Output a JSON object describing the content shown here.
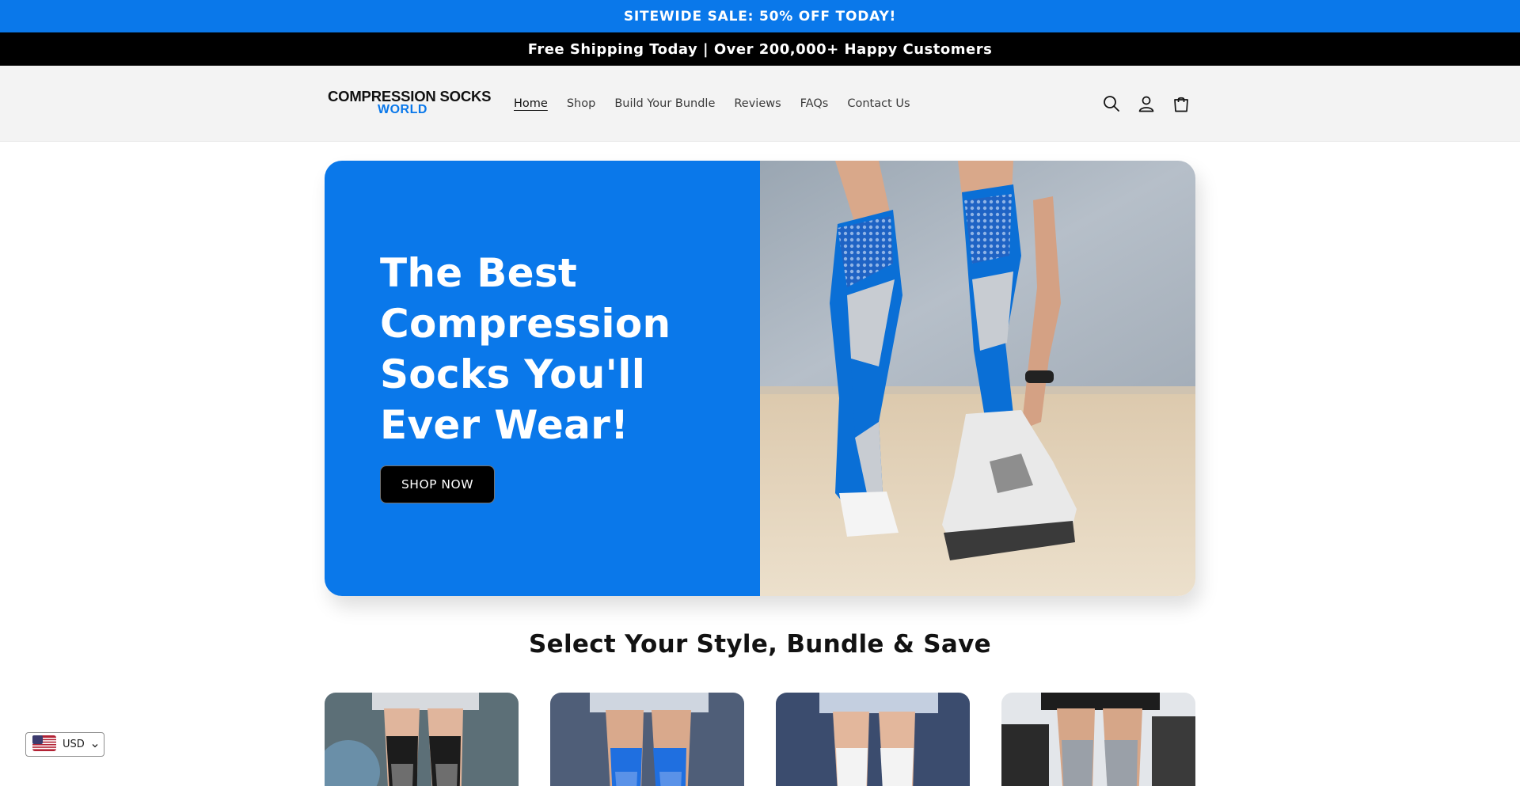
{
  "announcement": {
    "sale": "SITEWIDE SALE: 50% OFF TODAY!",
    "shipping": "Free Shipping Today | Over 200,000+ Happy Customers"
  },
  "header": {
    "logo_line1": "COMPRESSION SOCKS",
    "logo_line2": "WORLD",
    "nav": [
      {
        "label": "Home",
        "active": true
      },
      {
        "label": "Shop"
      },
      {
        "label": "Build Your Bundle"
      },
      {
        "label": "Reviews"
      },
      {
        "label": "FAQs"
      },
      {
        "label": "Contact Us"
      }
    ],
    "icons": [
      "search-icon",
      "account-icon",
      "cart-icon"
    ]
  },
  "hero": {
    "title": "The Best Compression Socks You'll Ever Wear!",
    "button": "SHOP NOW"
  },
  "collection": {
    "title": "Select Your Style, Bundle & Save"
  },
  "currency": {
    "code": "USD"
  },
  "colors": {
    "brand_blue": "#0a78ea",
    "black": "#000000",
    "header_bg": "#f3f3f3"
  }
}
